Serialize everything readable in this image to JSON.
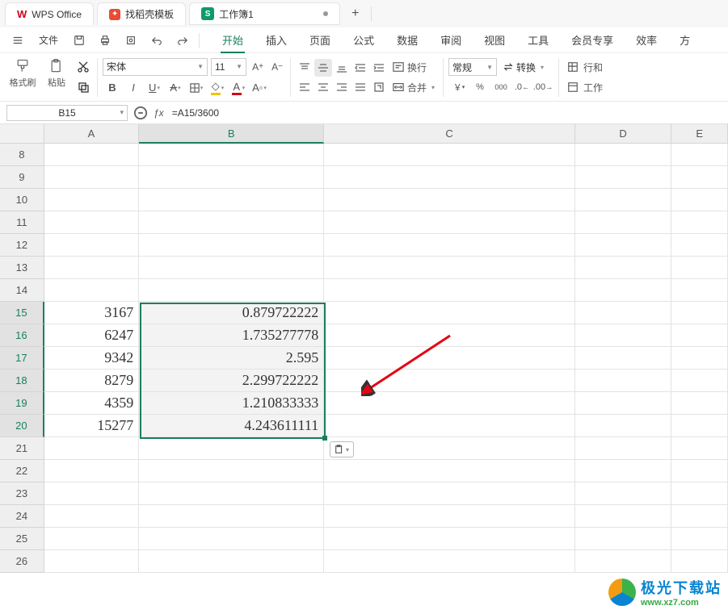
{
  "app": {
    "name": "WPS Office"
  },
  "tabs": {
    "template_tab": "找稻壳模板",
    "doc_tab": "工作簿1"
  },
  "menubar": {
    "file": "文件",
    "start": "开始",
    "insert": "插入",
    "page": "页面",
    "formula": "公式",
    "data": "数据",
    "review": "审阅",
    "view": "视图",
    "tools": "工具",
    "member": "会员专享",
    "efficiency": "效率",
    "fang": "方"
  },
  "ribbon": {
    "format_painter": "格式刷",
    "paste": "粘贴",
    "font_name": "宋体",
    "font_size": "11",
    "wrap": "换行",
    "merge": "合并",
    "num_general": "常规",
    "convert": "转换",
    "row_col": "行和",
    "worksheet": "工作"
  },
  "namebox": "B15",
  "formula": "=A15/3600",
  "cols": [
    "A",
    "B",
    "C",
    "D",
    "E"
  ],
  "rows": [
    "8",
    "9",
    "10",
    "11",
    "12",
    "13",
    "14",
    "15",
    "16",
    "17",
    "18",
    "19",
    "20",
    "21",
    "22",
    "23",
    "24",
    "25",
    "26"
  ],
  "cells": {
    "A15": "3167",
    "B15": "0.879722222",
    "A16": "6247",
    "B16": "1.735277778",
    "A17": "9342",
    "B17": "2.595",
    "A18": "8279",
    "B18": "2.299722222",
    "A19": "4359",
    "B19": "1.210833333",
    "A20": "15277",
    "B20": "4.243611111"
  },
  "watermark": {
    "main": "极光下载站",
    "sub": "www.xz7.com"
  }
}
